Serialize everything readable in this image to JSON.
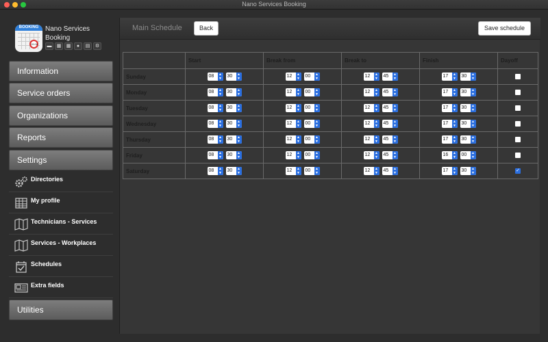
{
  "window": {
    "title": "Nano Services Booking"
  },
  "app": {
    "name": "Nano Services Booking",
    "logo_text": "BOOKING",
    "logo_pin": "28.08",
    "mini_icons": [
      "folder-icon",
      "calendar-icon",
      "calendar-icon",
      "user-icon",
      "book-icon",
      "gears-icon"
    ]
  },
  "sidebar": {
    "menu": [
      "Information",
      "Service orders",
      "Organizations",
      "Reports",
      "Settings",
      "Utilities"
    ],
    "sub_items": [
      {
        "label": "Directories",
        "icon": "gears-icon"
      },
      {
        "label": "My profile",
        "icon": "table-icon"
      },
      {
        "label": "Technicians - Services",
        "icon": "map-icon"
      },
      {
        "label": "Services - Workplaces",
        "icon": "map-icon"
      },
      {
        "label": "Schedules",
        "icon": "calendar-check-icon"
      },
      {
        "label": "Extra fields",
        "icon": "newspaper-icon"
      }
    ]
  },
  "toolbar": {
    "title": "Main Schedule",
    "back_label": "Back",
    "save_label": "Save schedule"
  },
  "schedule": {
    "headers": [
      "",
      "Start",
      "Break from",
      "Break to",
      "Finish",
      "Dayoff"
    ],
    "rows": [
      {
        "day": "Sunday",
        "start": [
          "08",
          "30"
        ],
        "break_from": [
          "12",
          "00"
        ],
        "break_to": [
          "12",
          "45"
        ],
        "finish": [
          "17",
          "30"
        ],
        "dayoff": false
      },
      {
        "day": "Monday",
        "start": [
          "08",
          "30"
        ],
        "break_from": [
          "12",
          "00"
        ],
        "break_to": [
          "12",
          "45"
        ],
        "finish": [
          "17",
          "30"
        ],
        "dayoff": false
      },
      {
        "day": "Tuesday",
        "start": [
          "08",
          "30"
        ],
        "break_from": [
          "12",
          "00"
        ],
        "break_to": [
          "12",
          "45"
        ],
        "finish": [
          "17",
          "30"
        ],
        "dayoff": false
      },
      {
        "day": "Wednesday",
        "start": [
          "08",
          "30"
        ],
        "break_from": [
          "12",
          "00"
        ],
        "break_to": [
          "12",
          "45"
        ],
        "finish": [
          "17",
          "30"
        ],
        "dayoff": false
      },
      {
        "day": "Thursday",
        "start": [
          "08",
          "30"
        ],
        "break_from": [
          "12",
          "00"
        ],
        "break_to": [
          "12",
          "45"
        ],
        "finish": [
          "17",
          "30"
        ],
        "dayoff": false
      },
      {
        "day": "Friday",
        "start": [
          "08",
          "30"
        ],
        "break_from": [
          "12",
          "00"
        ],
        "break_to": [
          "12",
          "45"
        ],
        "finish": [
          "16",
          "00"
        ],
        "dayoff": false
      },
      {
        "day": "Saturday",
        "start": [
          "08",
          "30"
        ],
        "break_from": [
          "12",
          "00"
        ],
        "break_to": [
          "12",
          "45"
        ],
        "finish": [
          "17",
          "30"
        ],
        "dayoff": true
      }
    ]
  },
  "colors": {
    "accent": "#2b6fe0",
    "panel": "#363636",
    "menu": "#6e6e6e"
  }
}
